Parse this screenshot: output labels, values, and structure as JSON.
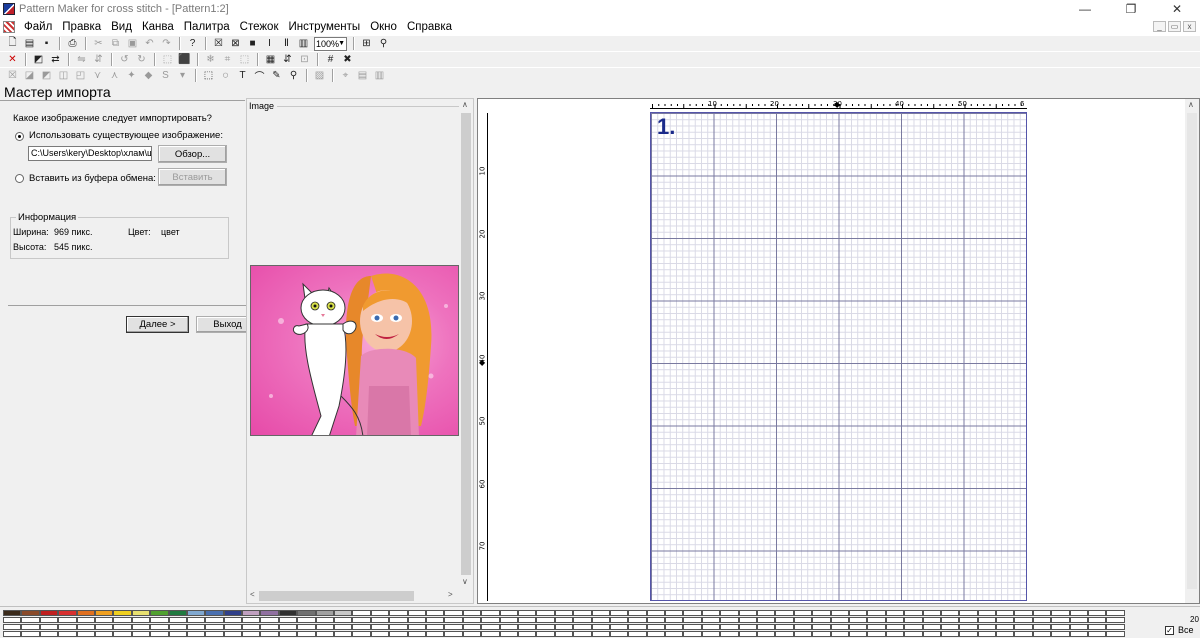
{
  "window": {
    "title": "Pattern Maker for cross stitch - [Pattern1:2]",
    "minimize": "—",
    "restore": "❐",
    "close": "✕"
  },
  "menu": [
    "Файл",
    "Правка",
    "Вид",
    "Канва",
    "Палитра",
    "Стежок",
    "Инструменты",
    "Окно",
    "Справка"
  ],
  "toolbar": {
    "zoom": "100%",
    "text_tool": "T",
    "shape_tool": "S",
    "bold_tool": "I"
  },
  "wizard": {
    "title": "Мастер импорта",
    "question": "Какое изображение следует импортировать?",
    "option_existing": "Использовать существующее изображение:",
    "path_value": "C:\\Users\\kery\\Desktop\\хлам\\щщ",
    "browse_button": "Обзор...",
    "option_clipboard": "Вставить из буфера обмена:",
    "paste_button": "Вставить",
    "info": {
      "group_label": "Информация",
      "width_label": "Ширина:",
      "width_value": "969 пикс.",
      "height_label": "Высота:",
      "height_value": "545 пикс.",
      "color_label": "Цвет:",
      "color_value": "цвет"
    },
    "next_button": "Далее >",
    "exit_button": "Выход"
  },
  "preview": {
    "label": "Image"
  },
  "canvas": {
    "page_number": "1.",
    "h_ruler_labels": [
      "10",
      "20",
      "30",
      "40",
      "50",
      "6"
    ],
    "v_ruler_labels": [
      "10",
      "20",
      "30",
      "40",
      "50",
      "60",
      "70"
    ]
  },
  "palette": {
    "colors": [
      "#3a2a1a",
      "#8a4a2a",
      "#c02020",
      "#d83030",
      "#e07020",
      "#f0a020",
      "#f0d020",
      "#e8e070",
      "#50a030",
      "#207a40",
      "#80a8d0",
      "#4a70b0",
      "#30408a",
      "#c0a0c0",
      "#9070a0",
      "#303030",
      "#707070",
      "#a0a0a0",
      "#c8c8c8"
    ],
    "count": "20",
    "all_label": "Все"
  }
}
